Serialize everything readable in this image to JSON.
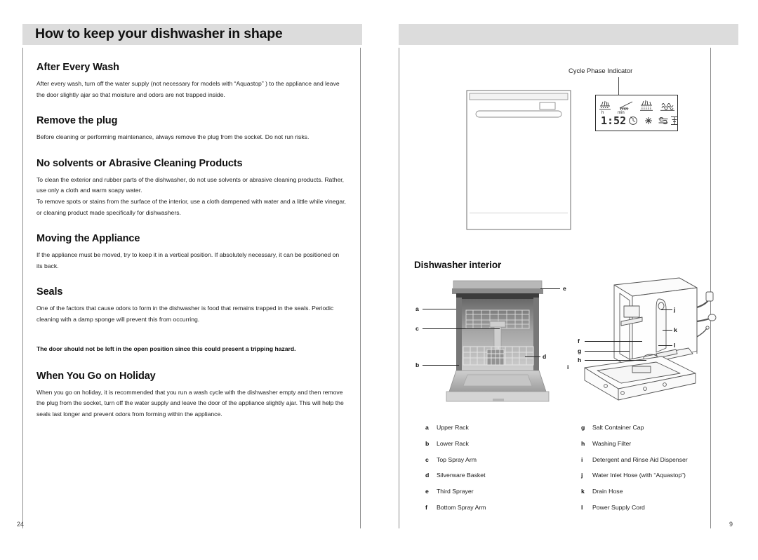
{
  "document": {
    "left_page": {
      "header": "How to keep your dishwasher in shape",
      "page_number": "24",
      "sections": [
        {
          "heading": "After Every Wash",
          "paragraphs": [
            "After every wash, turn off the water supply (not necessary for models with “Aquastop” ) to the appliance and leave the door slightly ajar so that moisture and odors are not trapped inside."
          ]
        },
        {
          "heading": "Remove the plug",
          "paragraphs": [
            "Before cleaning or performing maintenance, always remove the plug from the socket. Do not run risks."
          ]
        },
        {
          "heading": "No solvents or Abrasive Cleaning Products",
          "paragraphs": [
            "To clean the exterior and rubber parts of the dishwasher, do not use solvents or abrasive cleaning products. Rather, use only a cloth and warm soapy water.",
            "To remove spots or stains from the surface of the interior, use a cloth dampened with water and a little while vinegar, or cleaning product made specifically for dishwashers."
          ]
        },
        {
          "heading": "Moving the Appliance",
          "paragraphs": [
            "If the appliance must be moved, try to keep it in a vertical position. If absolutely necessary, it can be positioned on its back."
          ]
        },
        {
          "heading": "Seals",
          "paragraphs": [
            "One of the factors that cause odors to form in the dishwasher is food that remains trapped in the seals. Periodic cleaning with a damp sponge will prevent this from occurring."
          ]
        }
      ],
      "warning": "The door should not be left in the open position since this could present a tripping hazard.",
      "final_section": {
        "heading": "When You Go on Holiday",
        "paragraphs": [
          "When you go on holiday, it is recommended that you run a wash cycle with the dishwasher empty and then remove the plug from the socket, turn off the water supply and leave the door of the appliance slightly ajar. This will help the seals last longer and prevent odors from forming within the appliance."
        ]
      }
    },
    "right_page": {
      "header": "",
      "page_number": "9",
      "cycle_phase_indicator_label": "Cycle Phase Indicator",
      "lcd": {
        "time": "1:52",
        "hour_unit": "h",
        "minute_unit": "min",
        "phase_icons": [
          "prewash-icon",
          "wash-icon",
          "rinse-icon",
          "dry-icon"
        ],
        "status_icons": [
          "delay-timer-icon",
          "sparkle-icon",
          "s-cycle-icon",
          "hourglass-icon"
        ]
      },
      "interior_heading": "Dishwasher interior",
      "photo_callouts": [
        "e",
        "a",
        "c",
        "b",
        "d"
      ],
      "drawing_callouts": [
        "f",
        "g",
        "h",
        "i",
        "j",
        "k",
        "l"
      ],
      "legend_left": [
        {
          "key": "a",
          "text": "Upper Rack"
        },
        {
          "key": "b",
          "text": "Lower Rack"
        },
        {
          "key": "c",
          "text": "Top Spray Arm"
        },
        {
          "key": "d",
          "text": "Silverware Basket"
        },
        {
          "key": "e",
          "text": "Third Sprayer"
        },
        {
          "key": "f",
          "text": "Bottom Spray Arm"
        }
      ],
      "legend_right": [
        {
          "key": "g",
          "text": "Salt Container Cap"
        },
        {
          "key": "h",
          "text": "Washing Filter"
        },
        {
          "key": "i",
          "text": "Detergent and Rinse Aid Dispenser"
        },
        {
          "key": "j",
          "text": "Water Inlet Hose (with “Aquastop”)"
        },
        {
          "key": "k",
          "text": "Drain Hose"
        },
        {
          "key": "l",
          "text": "Power Supply Cord"
        }
      ]
    },
    "colors": {
      "banner": "#dcdcdc",
      "rule": "#8c8c8c",
      "text": "#1b1b1b"
    }
  }
}
